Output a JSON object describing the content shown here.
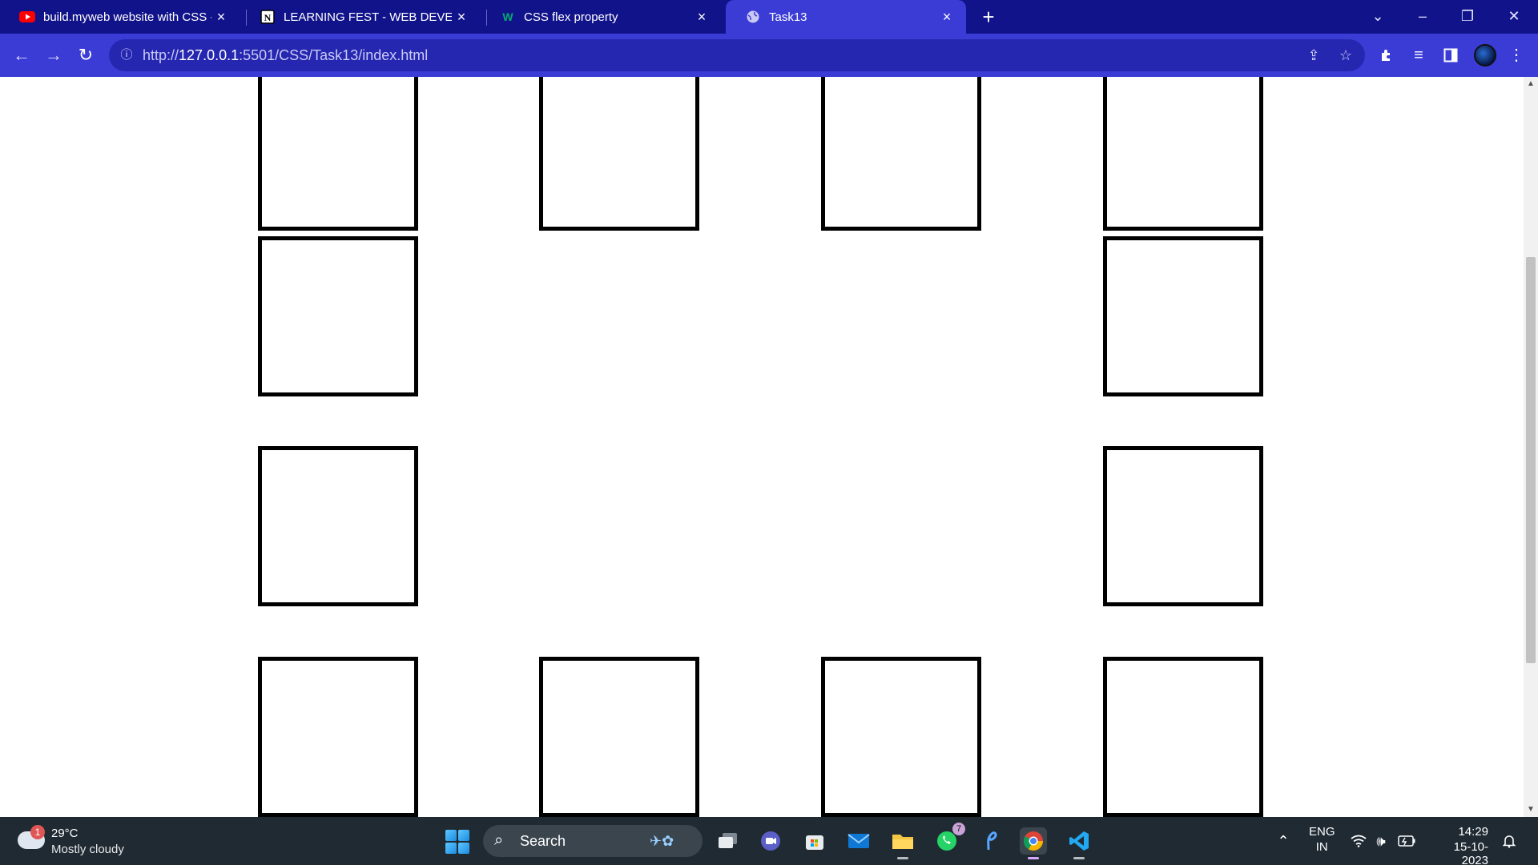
{
  "browser": {
    "tabs": [
      {
        "title": "build.myweb website with CSS -",
        "favicon": "youtube-icon",
        "active": false
      },
      {
        "title": "LEARNING FEST - WEB DEVELOP",
        "favicon": "notion-icon",
        "active": false
      },
      {
        "title": "CSS flex property",
        "favicon": "w3schools-icon",
        "active": false
      },
      {
        "title": "Task13",
        "favicon": "globe-icon",
        "active": true
      }
    ],
    "url_prefix": "http://",
    "url_host": "127.0.0.1",
    "url_rest": ":5501/CSS/Task13/index.html",
    "colors": {
      "tabstrip": "#11138a",
      "toolbar": "#3b3bd6",
      "omnibox": "#2627b0"
    }
  },
  "page": {
    "box_count": 12,
    "box_border_color": "#000000"
  },
  "taskbar": {
    "weather": {
      "badge": "1",
      "temperature": "29°C",
      "condition": "Mostly cloudy"
    },
    "search_label": "Search",
    "apps": [
      "task-view-icon",
      "teams-icon",
      "store-icon",
      "mail-icon",
      "file-explorer-icon",
      "whatsapp-icon",
      "pen-icon",
      "chrome-icon",
      "vscode-icon"
    ],
    "whatsapp_badge": "7",
    "language": "ENG",
    "region": "IN",
    "time": "14:29",
    "date": "15-10-2023"
  }
}
